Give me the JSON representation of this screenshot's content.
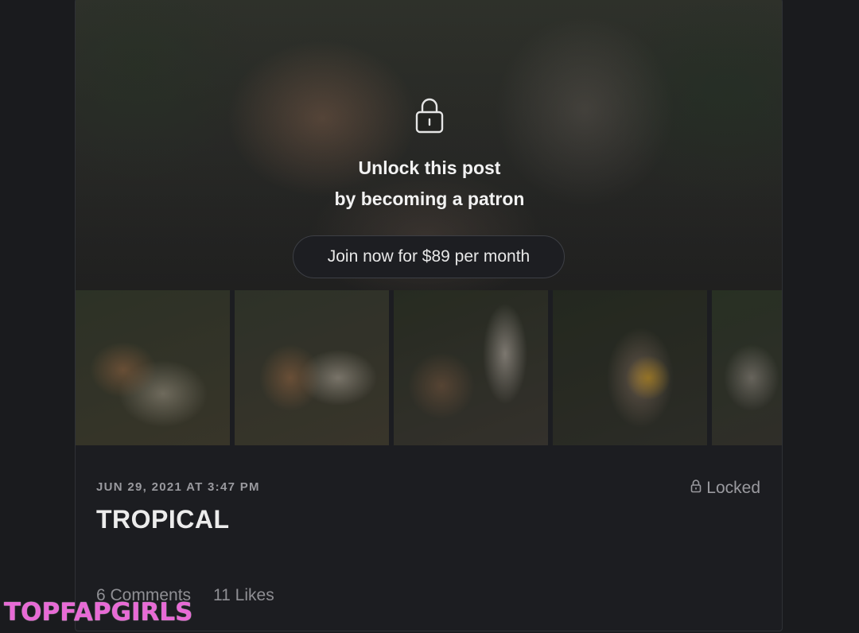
{
  "post": {
    "unlock_line1": "Unlock this post",
    "unlock_line2": "by becoming a patron",
    "join_label": "Join now for $89 per month",
    "date": "JUN 29, 2021 AT 3:47 PM",
    "locked_label": "Locked",
    "title": "TROPICAL",
    "comments": "6 Comments",
    "likes": "11 Likes"
  },
  "watermark": "TOPFAPGIRLS",
  "icons": {
    "hero_lock": "padlock-icon",
    "locked_badge": "small-padlock-icon"
  },
  "colors": {
    "background": "#1a1b1e",
    "card": "#1c1d21",
    "watermark": "#e86ad6"
  }
}
